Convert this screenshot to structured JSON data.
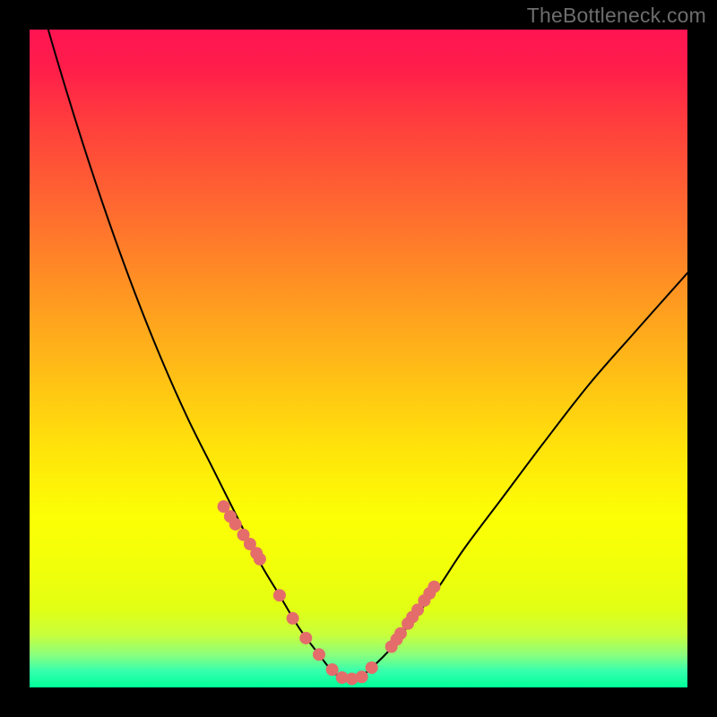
{
  "watermark": "TheBottleneck.com",
  "chart_data": {
    "type": "line",
    "title": "",
    "xlabel": "",
    "ylabel": "",
    "x_range": [
      0,
      100
    ],
    "y_range": [
      0,
      100
    ],
    "notes": "V-shaped bottleneck curve with minimum near x≈47; salmon dots cluster near trough; background is vertical red→yellow→green gradient.",
    "series": [
      {
        "name": "curve",
        "x": [
          0,
          4,
          8,
          12,
          16,
          20,
          24,
          28,
          32,
          35,
          38,
          41,
          44,
          46,
          48,
          50,
          52,
          55,
          58,
          62,
          66,
          72,
          78,
          85,
          92,
          100
        ],
        "y": [
          110,
          96,
          83,
          71,
          60,
          50,
          41,
          33,
          25,
          19,
          14,
          9,
          5,
          2.5,
          1.2,
          1.5,
          3,
          6,
          10,
          15,
          21,
          29,
          37,
          46,
          54,
          63
        ]
      }
    ],
    "dots": {
      "x": [
        29.5,
        30.5,
        31.3,
        32.5,
        33.5,
        34.5,
        35.0,
        38.0,
        40.0,
        42.0,
        44.0,
        46.0,
        47.5,
        49.0,
        50.5,
        52.0,
        55.0,
        55.8,
        56.4,
        57.5,
        58.2,
        59.0,
        60.0,
        60.8,
        61.5
      ],
      "y": [
        27.5,
        26.0,
        24.8,
        23.2,
        21.8,
        20.4,
        19.5,
        14.0,
        10.5,
        7.5,
        5.0,
        2.7,
        1.5,
        1.3,
        1.6,
        3.0,
        6.2,
        7.3,
        8.2,
        9.7,
        10.7,
        11.8,
        13.2,
        14.3,
        15.3
      ]
    }
  }
}
